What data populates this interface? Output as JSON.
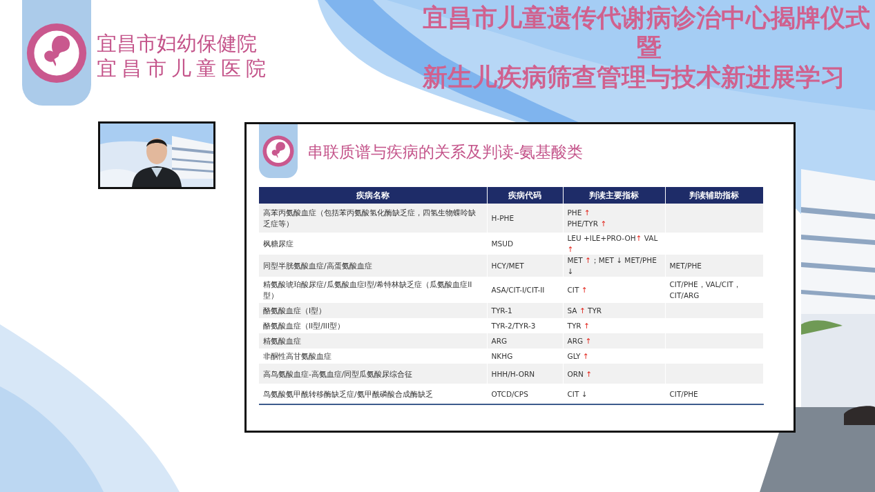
{
  "header": {
    "hospital_names": [
      "宜昌市妇幼保健院",
      "宜昌市儿童医院"
    ],
    "event_title": [
      "宜昌市儿童遗传代谢病诊治中心揭牌仪式",
      "暨",
      "新生儿疾病筛查管理与技术新进展学习"
    ]
  },
  "slide": {
    "title": "串联质谱与疾病的关系及判读-氨基酸类",
    "table": {
      "columns": [
        "疾病名称",
        "疾病代码",
        "判读主要指标",
        "判读辅助指标"
      ],
      "rows": [
        {
          "name": "高苯丙氨酸血症（包括苯丙氨酸氢化酶缺乏症，四氢生物蝶呤缺乏症等）",
          "code": "H-PHE",
          "main": [
            [
              {
                "text": "PHE ",
                "kind": "plain"
              },
              {
                "text": "↑",
                "kind": "up"
              }
            ],
            [
              {
                "text": "PHE/TYR ",
                "kind": "plain"
              },
              {
                "text": "↑",
                "kind": "up"
              }
            ]
          ]
        },
        {
          "name": "枫糖尿症",
          "code": "MSUD",
          "main": [
            [
              {
                "text": "LEU +ILE+PRO-OH",
                "kind": "plain"
              },
              {
                "text": "↑",
                "kind": "up"
              },
              {
                "text": " VAL ",
                "kind": "plain"
              },
              {
                "text": "↑",
                "kind": "up"
              }
            ]
          ]
        },
        {
          "name": "同型半胱氨酸血症/高蛋氨酸血症",
          "code": "HCY/MET",
          "main": [
            [
              {
                "text": "MET ",
                "kind": "plain"
              },
              {
                "text": "↑",
                "kind": "up"
              },
              {
                "text": "；MET ",
                "kind": "plain"
              },
              {
                "text": "↓",
                "kind": "down"
              },
              {
                "text": " MET/PHE ",
                "kind": "plain"
              },
              {
                "text": "↓",
                "kind": "down"
              }
            ]
          ],
          "aux": "MET/PHE"
        },
        {
          "name": "精氨酸琥珀酸尿症/瓜氨酸血症I型/希特林缺乏症（瓜氨酸血症II型）",
          "code": "ASA/CIT-I/CIT-II",
          "main": [
            [
              {
                "text": "CIT ",
                "kind": "plain"
              },
              {
                "text": "↑",
                "kind": "up"
              }
            ]
          ],
          "aux": "CIT/PHE，VAL/CIT，CIT/ARG"
        },
        {
          "name": "酪氨酸血症（I型）",
          "code": "TYR-1",
          "main": [
            [
              {
                "text": "SA ",
                "kind": "plain"
              },
              {
                "text": "↑",
                "kind": "up"
              },
              {
                "text": " TYR",
                "kind": "plain"
              }
            ]
          ]
        },
        {
          "name": "酪氨酸血症（II型/III型）",
          "code": "TYR-2/TYR-3",
          "main": [
            [
              {
                "text": "TYR ",
                "kind": "plain"
              },
              {
                "text": "↑",
                "kind": "up"
              }
            ]
          ]
        },
        {
          "name": "精氨酸血症",
          "code": "ARG",
          "main": [
            [
              {
                "text": "ARG ",
                "kind": "plain"
              },
              {
                "text": "↑",
                "kind": "up"
              }
            ]
          ]
        },
        {
          "name": "非酮性高甘氨酸血症",
          "code": "NKHG",
          "main": [
            [
              {
                "text": "GLY ",
                "kind": "plain"
              },
              {
                "text": "↑",
                "kind": "up"
              }
            ]
          ]
        },
        {
          "name": "高鸟氨酸血症-高氨血症/同型瓜氨酸尿综合征",
          "code": "HHH/H-ORN",
          "main": [
            [
              {
                "text": "ORN ",
                "kind": "plain"
              },
              {
                "text": "↑",
                "kind": "up"
              }
            ]
          ]
        },
        {
          "name": "鸟氨酸氨甲酰转移酶缺乏症/氨甲酰磷酸合成酶缺乏",
          "code": "OTCD/CPS",
          "main": [
            [
              {
                "text": "CIT ",
                "kind": "plain"
              },
              {
                "text": "↓",
                "kind": "down"
              }
            ]
          ],
          "aux": "CIT/PHE"
        }
      ]
    }
  }
}
